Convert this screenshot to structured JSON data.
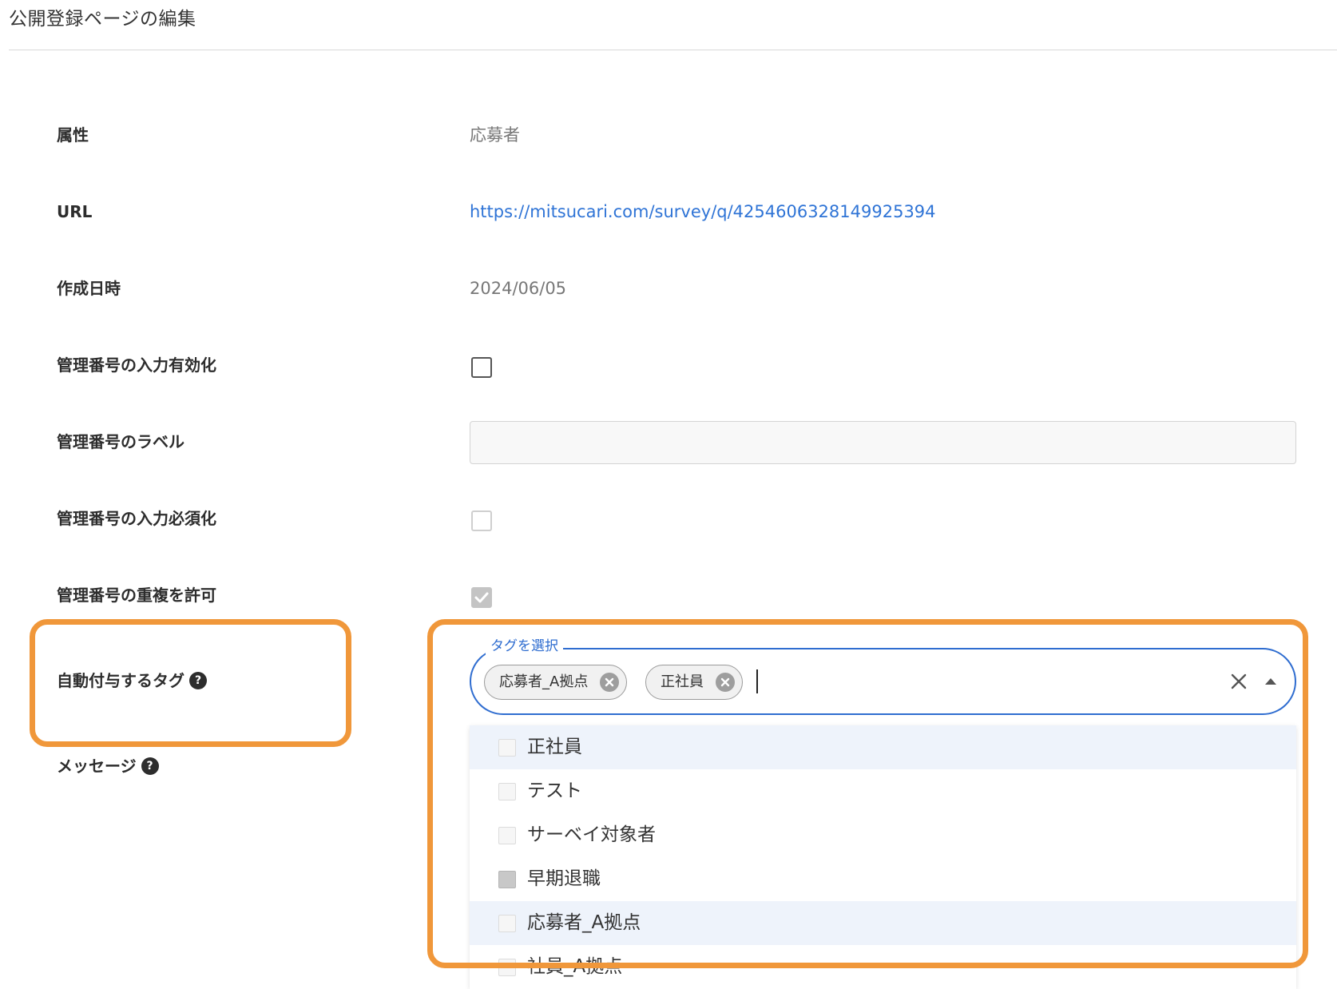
{
  "page": {
    "title": "公開登録ページの編集"
  },
  "fields": {
    "attribute": {
      "label": "属性",
      "value": "応募者"
    },
    "url": {
      "label": "URL",
      "value": "https://mitsucari.com/survey/q/4254606328149925394"
    },
    "created_at": {
      "label": "作成日時",
      "value": "2024/06/05"
    },
    "enable_mgmt_number": {
      "label": "管理番号の入力有効化",
      "checked": false
    },
    "mgmt_number_label": {
      "label": "管理番号のラベル",
      "value": ""
    },
    "require_mgmt_number": {
      "label": "管理番号の入力必須化",
      "checked": false
    },
    "allow_duplicate": {
      "label": "管理番号の重複を許可",
      "checked": true
    },
    "auto_tags": {
      "label": "自動付与するタグ"
    },
    "message": {
      "label": "メッセージ"
    }
  },
  "help_icon_text": "?",
  "tag_select": {
    "floating_label": "タグを選択",
    "selected": [
      "応募者_A拠点",
      "正社員"
    ],
    "options": [
      {
        "label": "正社員",
        "checked": false,
        "highlighted": true
      },
      {
        "label": "テスト",
        "checked": false,
        "highlighted": false
      },
      {
        "label": "サーベイ対象者",
        "checked": false,
        "highlighted": false
      },
      {
        "label": "早期退職",
        "checked": true,
        "highlighted": false
      },
      {
        "label": "応募者_A拠点",
        "checked": false,
        "highlighted": true
      },
      {
        "label": "社員_A拠点",
        "checked": false,
        "highlighted": false
      }
    ]
  },
  "colors": {
    "accent_blue": "#2f6dd0",
    "link_blue": "#2f74d6",
    "highlight_orange": "#f0973a"
  },
  "icons": {
    "help": "question-circle-icon",
    "chip_remove": "close-circle-icon",
    "clear": "close-icon",
    "toggle": "arrow-up-icon",
    "checkmark": "check-icon"
  }
}
